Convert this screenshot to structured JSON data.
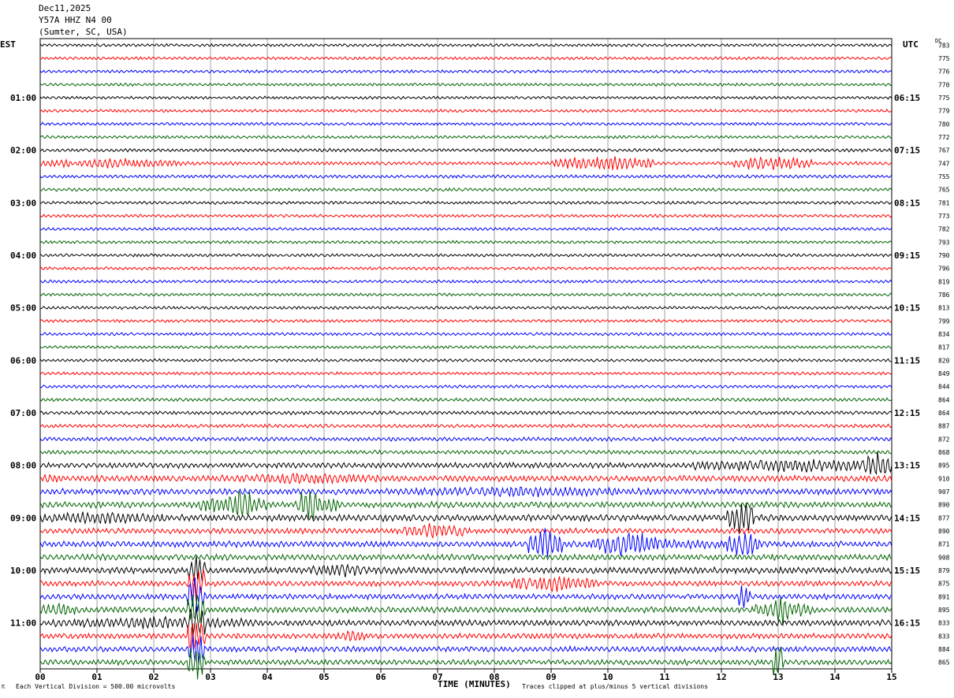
{
  "header": {
    "date": "Dec11,2025",
    "station": "Y57A HHZ N4 00",
    "location": "(Sumter, SC, USA)"
  },
  "left_zone_label": "EST",
  "right_zone_label": "UTC",
  "dc_label": "DC",
  "footer": {
    "scale_note": "Each Vertical Division =  500.00 microvolts",
    "clip_note": "Traces clipped at plus/minus 5 vertical divisions"
  },
  "chart_data": {
    "type": "line",
    "xlabel": "TIME (MINUTES)",
    "xlim": [
      0,
      15
    ],
    "x_ticks": [
      "00",
      "01",
      "02",
      "03",
      "04",
      "05",
      "06",
      "07",
      "08",
      "09",
      "10",
      "11",
      "12",
      "13",
      "14",
      "15"
    ],
    "trace_colors": [
      "#000000",
      "#ff0000",
      "#0000ff",
      "#006400"
    ],
    "left_hour_labels": [
      "01:00",
      "02:00",
      "03:00",
      "04:00",
      "05:00",
      "06:00",
      "07:00",
      "08:00",
      "09:00",
      "10:00",
      "11:00"
    ],
    "right_hour_labels": [
      "06:15",
      "07:15",
      "08:15",
      "09:15",
      "10:15",
      "11:15",
      "12:15",
      "13:15",
      "14:15",
      "15:15",
      "16:15"
    ],
    "trace_count": 48,
    "dc_offsets": [
      783,
      775,
      776,
      770,
      775,
      779,
      780,
      772,
      767,
      747,
      755,
      765,
      781,
      773,
      782,
      793,
      790,
      796,
      819,
      786,
      813,
      799,
      834,
      817,
      820,
      849,
      844,
      864,
      864,
      887,
      872,
      868,
      895,
      910,
      907,
      890,
      877,
      890,
      871,
      908,
      879,
      875,
      891,
      895,
      833,
      833,
      884,
      865
    ],
    "noise_amplitude": [
      0.25,
      0.25,
      0.25,
      0.25,
      0.25,
      0.25,
      0.25,
      0.25,
      0.28,
      0.3,
      0.27,
      0.27,
      0.25,
      0.25,
      0.25,
      0.25,
      0.25,
      0.25,
      0.25,
      0.25,
      0.25,
      0.25,
      0.25,
      0.25,
      0.25,
      0.25,
      0.25,
      0.28,
      0.3,
      0.3,
      0.33,
      0.33,
      0.45,
      0.5,
      0.5,
      0.5,
      0.55,
      0.45,
      0.5,
      0.5,
      0.55,
      0.45,
      0.45,
      0.5,
      0.5,
      0.45,
      0.45,
      0.45
    ],
    "events": [
      {
        "trace": 9,
        "start_min": 0.0,
        "end_min": 2.5,
        "amplitude": 0.9
      },
      {
        "trace": 9,
        "start_min": 9.0,
        "end_min": 10.8,
        "amplitude": 1.3
      },
      {
        "trace": 9,
        "start_min": 12.2,
        "end_min": 13.6,
        "amplitude": 1.3
      },
      {
        "trace": 32,
        "start_min": 11.5,
        "end_min": 15.0,
        "amplitude": 1.2
      },
      {
        "trace": 32,
        "start_min": 14.5,
        "end_min": 15.0,
        "amplitude": 2.4
      },
      {
        "trace": 33,
        "start_min": 0.0,
        "end_min": 0.3,
        "amplitude": 1.0
      },
      {
        "trace": 33,
        "start_min": 3.2,
        "end_min": 6.0,
        "amplitude": 1.0
      },
      {
        "trace": 34,
        "start_min": 5.8,
        "end_min": 11.0,
        "amplitude": 0.9
      },
      {
        "trace": 35,
        "start_min": 2.8,
        "end_min": 4.0,
        "amplitude": 1.8
      },
      {
        "trace": 35,
        "start_min": 4.5,
        "end_min": 5.3,
        "amplitude": 1.8
      },
      {
        "trace": 35,
        "start_min": 3.4,
        "end_min": 3.7,
        "amplitude": 3.5
      },
      {
        "trace": 35,
        "start_min": 4.6,
        "end_min": 4.9,
        "amplitude": 3.5
      },
      {
        "trace": 36,
        "start_min": 0.0,
        "end_min": 2.2,
        "amplitude": 1.2
      },
      {
        "trace": 36,
        "start_min": 12.1,
        "end_min": 12.6,
        "amplitude": 2.8
      },
      {
        "trace": 37,
        "start_min": 6.4,
        "end_min": 7.5,
        "amplitude": 1.4
      },
      {
        "trace": 38,
        "start_min": 8.6,
        "end_min": 9.2,
        "amplitude": 2.8
      },
      {
        "trace": 38,
        "start_min": 9.8,
        "end_min": 10.9,
        "amplitude": 2.2
      },
      {
        "trace": 38,
        "start_min": 12.1,
        "end_min": 12.7,
        "amplitude": 2.2
      },
      {
        "trace": 38,
        "start_min": 9.2,
        "end_min": 12.2,
        "amplitude": 1.0
      },
      {
        "trace": 40,
        "start_min": 4.8,
        "end_min": 5.8,
        "amplitude": 1.3
      },
      {
        "trace": 40,
        "start_min": 2.6,
        "end_min": 2.9,
        "amplitude": 3.5
      },
      {
        "trace": 41,
        "start_min": 8.3,
        "end_min": 9.8,
        "amplitude": 1.5
      },
      {
        "trace": 41,
        "start_min": 2.6,
        "end_min": 2.9,
        "amplitude": 3.5
      },
      {
        "trace": 42,
        "start_min": 2.6,
        "end_min": 2.9,
        "amplitude": 3.5
      },
      {
        "trace": 42,
        "start_min": 12.3,
        "end_min": 12.5,
        "amplitude": 2.5
      },
      {
        "trace": 43,
        "start_min": 0.0,
        "end_min": 0.7,
        "amplitude": 1.2
      },
      {
        "trace": 43,
        "start_min": 2.6,
        "end_min": 2.9,
        "amplitude": 3.5
      },
      {
        "trace": 43,
        "start_min": 12.6,
        "end_min": 13.6,
        "amplitude": 1.8
      },
      {
        "trace": 43,
        "start_min": 12.9,
        "end_min": 13.2,
        "amplitude": 3.5
      },
      {
        "trace": 44,
        "start_min": 0.2,
        "end_min": 3.8,
        "amplitude": 1.1
      },
      {
        "trace": 44,
        "start_min": 2.6,
        "end_min": 2.9,
        "amplitude": 3.5
      },
      {
        "trace": 45,
        "start_min": 2.6,
        "end_min": 2.9,
        "amplitude": 3.5
      },
      {
        "trace": 45,
        "start_min": 5.2,
        "end_min": 5.8,
        "amplitude": 1.1
      },
      {
        "trace": 46,
        "start_min": 2.6,
        "end_min": 2.9,
        "amplitude": 3.5
      },
      {
        "trace": 47,
        "start_min": 2.6,
        "end_min": 2.9,
        "amplitude": 3.5
      },
      {
        "trace": 47,
        "start_min": 12.9,
        "end_min": 13.1,
        "amplitude": 3.5
      }
    ]
  }
}
